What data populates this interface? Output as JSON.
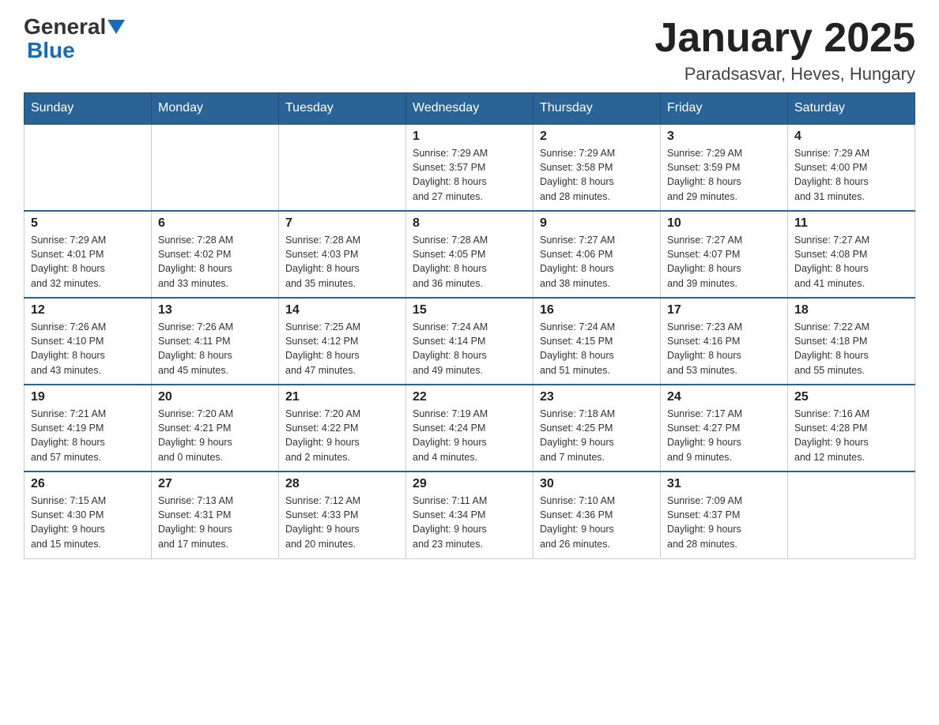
{
  "logo": {
    "text_general": "General",
    "text_blue": "Blue",
    "arrow": "▼"
  },
  "header": {
    "title": "January 2025",
    "subtitle": "Paradsasvar, Heves, Hungary"
  },
  "days_of_week": [
    "Sunday",
    "Monday",
    "Tuesday",
    "Wednesday",
    "Thursday",
    "Friday",
    "Saturday"
  ],
  "weeks": [
    [
      {
        "day": "",
        "info": ""
      },
      {
        "day": "",
        "info": ""
      },
      {
        "day": "",
        "info": ""
      },
      {
        "day": "1",
        "info": "Sunrise: 7:29 AM\nSunset: 3:57 PM\nDaylight: 8 hours\nand 27 minutes."
      },
      {
        "day": "2",
        "info": "Sunrise: 7:29 AM\nSunset: 3:58 PM\nDaylight: 8 hours\nand 28 minutes."
      },
      {
        "day": "3",
        "info": "Sunrise: 7:29 AM\nSunset: 3:59 PM\nDaylight: 8 hours\nand 29 minutes."
      },
      {
        "day": "4",
        "info": "Sunrise: 7:29 AM\nSunset: 4:00 PM\nDaylight: 8 hours\nand 31 minutes."
      }
    ],
    [
      {
        "day": "5",
        "info": "Sunrise: 7:29 AM\nSunset: 4:01 PM\nDaylight: 8 hours\nand 32 minutes."
      },
      {
        "day": "6",
        "info": "Sunrise: 7:28 AM\nSunset: 4:02 PM\nDaylight: 8 hours\nand 33 minutes."
      },
      {
        "day": "7",
        "info": "Sunrise: 7:28 AM\nSunset: 4:03 PM\nDaylight: 8 hours\nand 35 minutes."
      },
      {
        "day": "8",
        "info": "Sunrise: 7:28 AM\nSunset: 4:05 PM\nDaylight: 8 hours\nand 36 minutes."
      },
      {
        "day": "9",
        "info": "Sunrise: 7:27 AM\nSunset: 4:06 PM\nDaylight: 8 hours\nand 38 minutes."
      },
      {
        "day": "10",
        "info": "Sunrise: 7:27 AM\nSunset: 4:07 PM\nDaylight: 8 hours\nand 39 minutes."
      },
      {
        "day": "11",
        "info": "Sunrise: 7:27 AM\nSunset: 4:08 PM\nDaylight: 8 hours\nand 41 minutes."
      }
    ],
    [
      {
        "day": "12",
        "info": "Sunrise: 7:26 AM\nSunset: 4:10 PM\nDaylight: 8 hours\nand 43 minutes."
      },
      {
        "day": "13",
        "info": "Sunrise: 7:26 AM\nSunset: 4:11 PM\nDaylight: 8 hours\nand 45 minutes."
      },
      {
        "day": "14",
        "info": "Sunrise: 7:25 AM\nSunset: 4:12 PM\nDaylight: 8 hours\nand 47 minutes."
      },
      {
        "day": "15",
        "info": "Sunrise: 7:24 AM\nSunset: 4:14 PM\nDaylight: 8 hours\nand 49 minutes."
      },
      {
        "day": "16",
        "info": "Sunrise: 7:24 AM\nSunset: 4:15 PM\nDaylight: 8 hours\nand 51 minutes."
      },
      {
        "day": "17",
        "info": "Sunrise: 7:23 AM\nSunset: 4:16 PM\nDaylight: 8 hours\nand 53 minutes."
      },
      {
        "day": "18",
        "info": "Sunrise: 7:22 AM\nSunset: 4:18 PM\nDaylight: 8 hours\nand 55 minutes."
      }
    ],
    [
      {
        "day": "19",
        "info": "Sunrise: 7:21 AM\nSunset: 4:19 PM\nDaylight: 8 hours\nand 57 minutes."
      },
      {
        "day": "20",
        "info": "Sunrise: 7:20 AM\nSunset: 4:21 PM\nDaylight: 9 hours\nand 0 minutes."
      },
      {
        "day": "21",
        "info": "Sunrise: 7:20 AM\nSunset: 4:22 PM\nDaylight: 9 hours\nand 2 minutes."
      },
      {
        "day": "22",
        "info": "Sunrise: 7:19 AM\nSunset: 4:24 PM\nDaylight: 9 hours\nand 4 minutes."
      },
      {
        "day": "23",
        "info": "Sunrise: 7:18 AM\nSunset: 4:25 PM\nDaylight: 9 hours\nand 7 minutes."
      },
      {
        "day": "24",
        "info": "Sunrise: 7:17 AM\nSunset: 4:27 PM\nDaylight: 9 hours\nand 9 minutes."
      },
      {
        "day": "25",
        "info": "Sunrise: 7:16 AM\nSunset: 4:28 PM\nDaylight: 9 hours\nand 12 minutes."
      }
    ],
    [
      {
        "day": "26",
        "info": "Sunrise: 7:15 AM\nSunset: 4:30 PM\nDaylight: 9 hours\nand 15 minutes."
      },
      {
        "day": "27",
        "info": "Sunrise: 7:13 AM\nSunset: 4:31 PM\nDaylight: 9 hours\nand 17 minutes."
      },
      {
        "day": "28",
        "info": "Sunrise: 7:12 AM\nSunset: 4:33 PM\nDaylight: 9 hours\nand 20 minutes."
      },
      {
        "day": "29",
        "info": "Sunrise: 7:11 AM\nSunset: 4:34 PM\nDaylight: 9 hours\nand 23 minutes."
      },
      {
        "day": "30",
        "info": "Sunrise: 7:10 AM\nSunset: 4:36 PM\nDaylight: 9 hours\nand 26 minutes."
      },
      {
        "day": "31",
        "info": "Sunrise: 7:09 AM\nSunset: 4:37 PM\nDaylight: 9 hours\nand 28 minutes."
      },
      {
        "day": "",
        "info": ""
      }
    ]
  ]
}
